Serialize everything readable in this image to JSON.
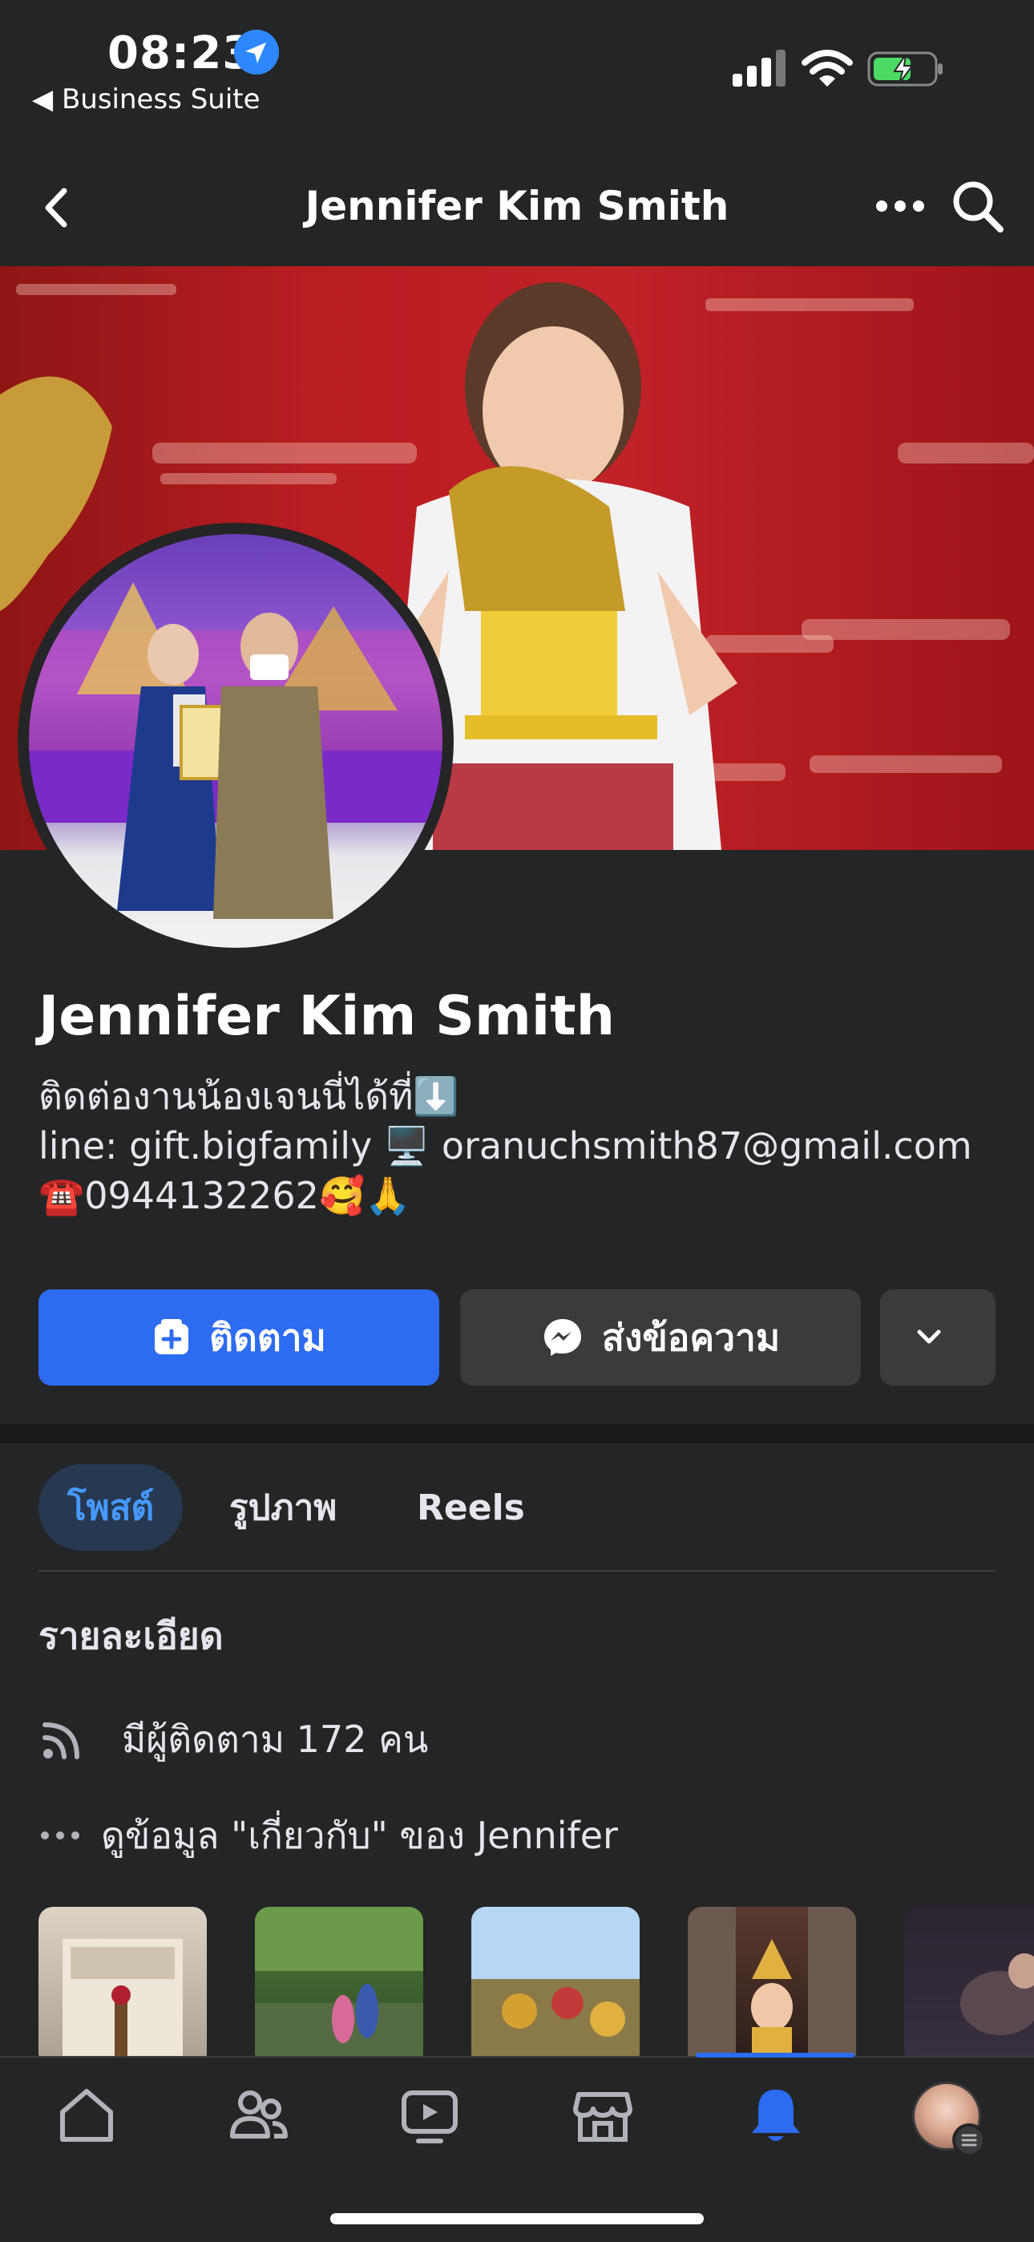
{
  "status_bar": {
    "time": "08:23",
    "back_app": "◀ Business Suite"
  },
  "nav": {
    "title": "Jennifer Kim Smith"
  },
  "profile": {
    "name": "Jennifer Kim Smith",
    "bio_line1": "ติดต่องานน้องเจนนี่ได้ที่⬇️",
    "bio_line2": "line: gift.bigfamily 🖥️ oranuchsmith87@gmail.com",
    "bio_line3": "☎️0944132262🥰🙏"
  },
  "actions": {
    "follow_label": "ติดตาม",
    "message_label": "ส่งข้อความ"
  },
  "tabs": [
    {
      "label": "โพสต์",
      "active": true
    },
    {
      "label": "รูปภาพ",
      "active": false
    },
    {
      "label": "Reels",
      "active": false
    }
  ],
  "details": {
    "heading": "รายละเอียด",
    "followers": "มีผู้ติดตาม 172 คน",
    "about": "ดูข้อมูล \"เกี่ยวกับ\" ของ Jennifer"
  },
  "bottom_tabs": [
    {
      "icon": "home-icon",
      "active": false
    },
    {
      "icon": "friends-icon",
      "active": false
    },
    {
      "icon": "video-icon",
      "active": false
    },
    {
      "icon": "marketplace-icon",
      "active": false
    },
    {
      "icon": "notifications-icon",
      "active": true
    },
    {
      "icon": "profile-menu-icon",
      "active": false
    }
  ],
  "colors": {
    "background": "#242526",
    "accent": "#2d6bf0",
    "active_tab_bg": "#263951",
    "active_tab_text": "#4599ff"
  }
}
